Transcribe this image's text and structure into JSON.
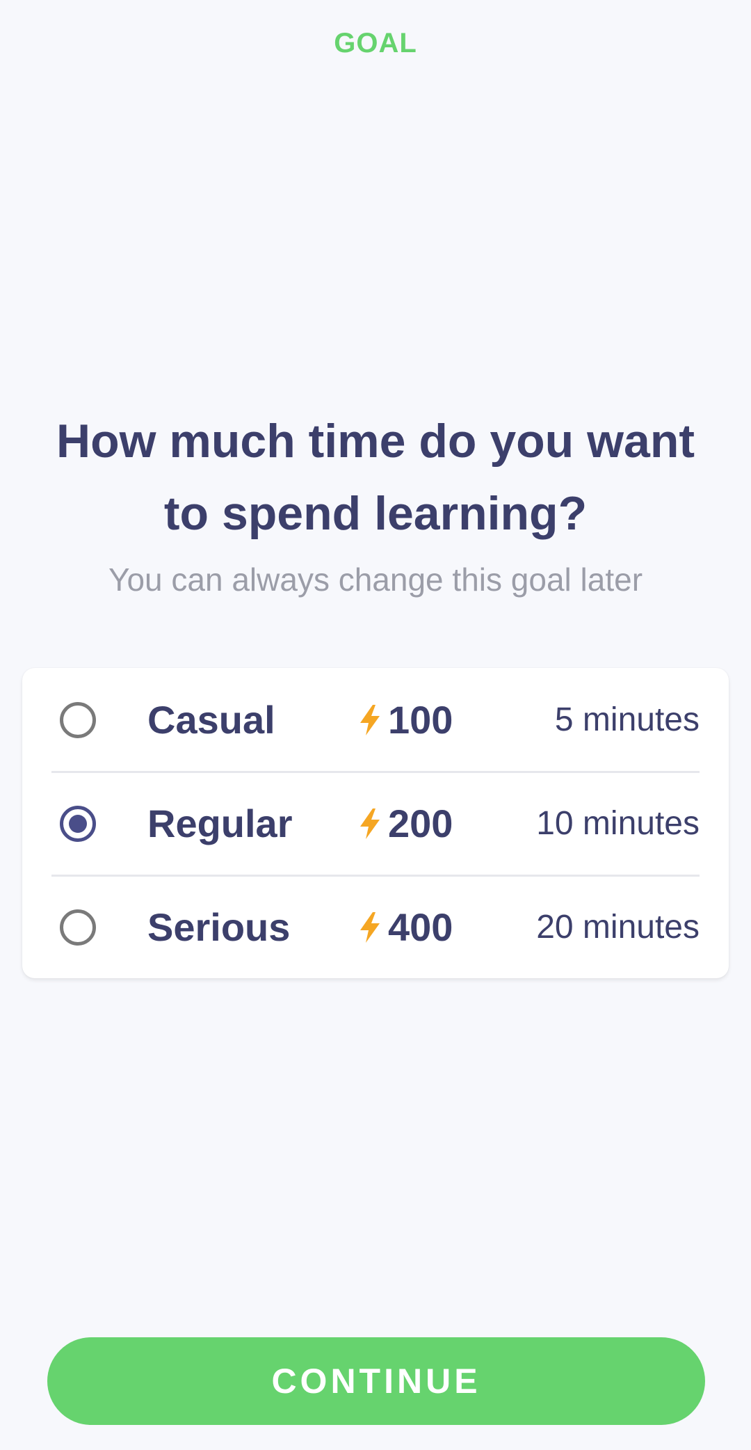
{
  "header": {
    "title": "GOAL"
  },
  "question": {
    "title": "How much time do you want to spend learning?",
    "subtitle": "You can always change this goal later"
  },
  "options": [
    {
      "label": "Casual",
      "xp": "100",
      "minutes": "5 minutes",
      "selected": false,
      "icon": "lightning-icon"
    },
    {
      "label": "Regular",
      "xp": "200",
      "minutes": "10 minutes",
      "selected": true,
      "icon": "lightning-icon"
    },
    {
      "label": "Serious",
      "xp": "400",
      "minutes": "20 minutes",
      "selected": false,
      "icon": "lightning-icon"
    }
  ],
  "footer": {
    "continue_label": "CONTINUE"
  },
  "colors": {
    "accent_green": "#66d36e",
    "text_primary": "#3c3f6b",
    "text_secondary": "#9b9da8",
    "radio_selected": "#4a4e89",
    "bolt": "#f5a623",
    "background": "#f7f8fc"
  }
}
